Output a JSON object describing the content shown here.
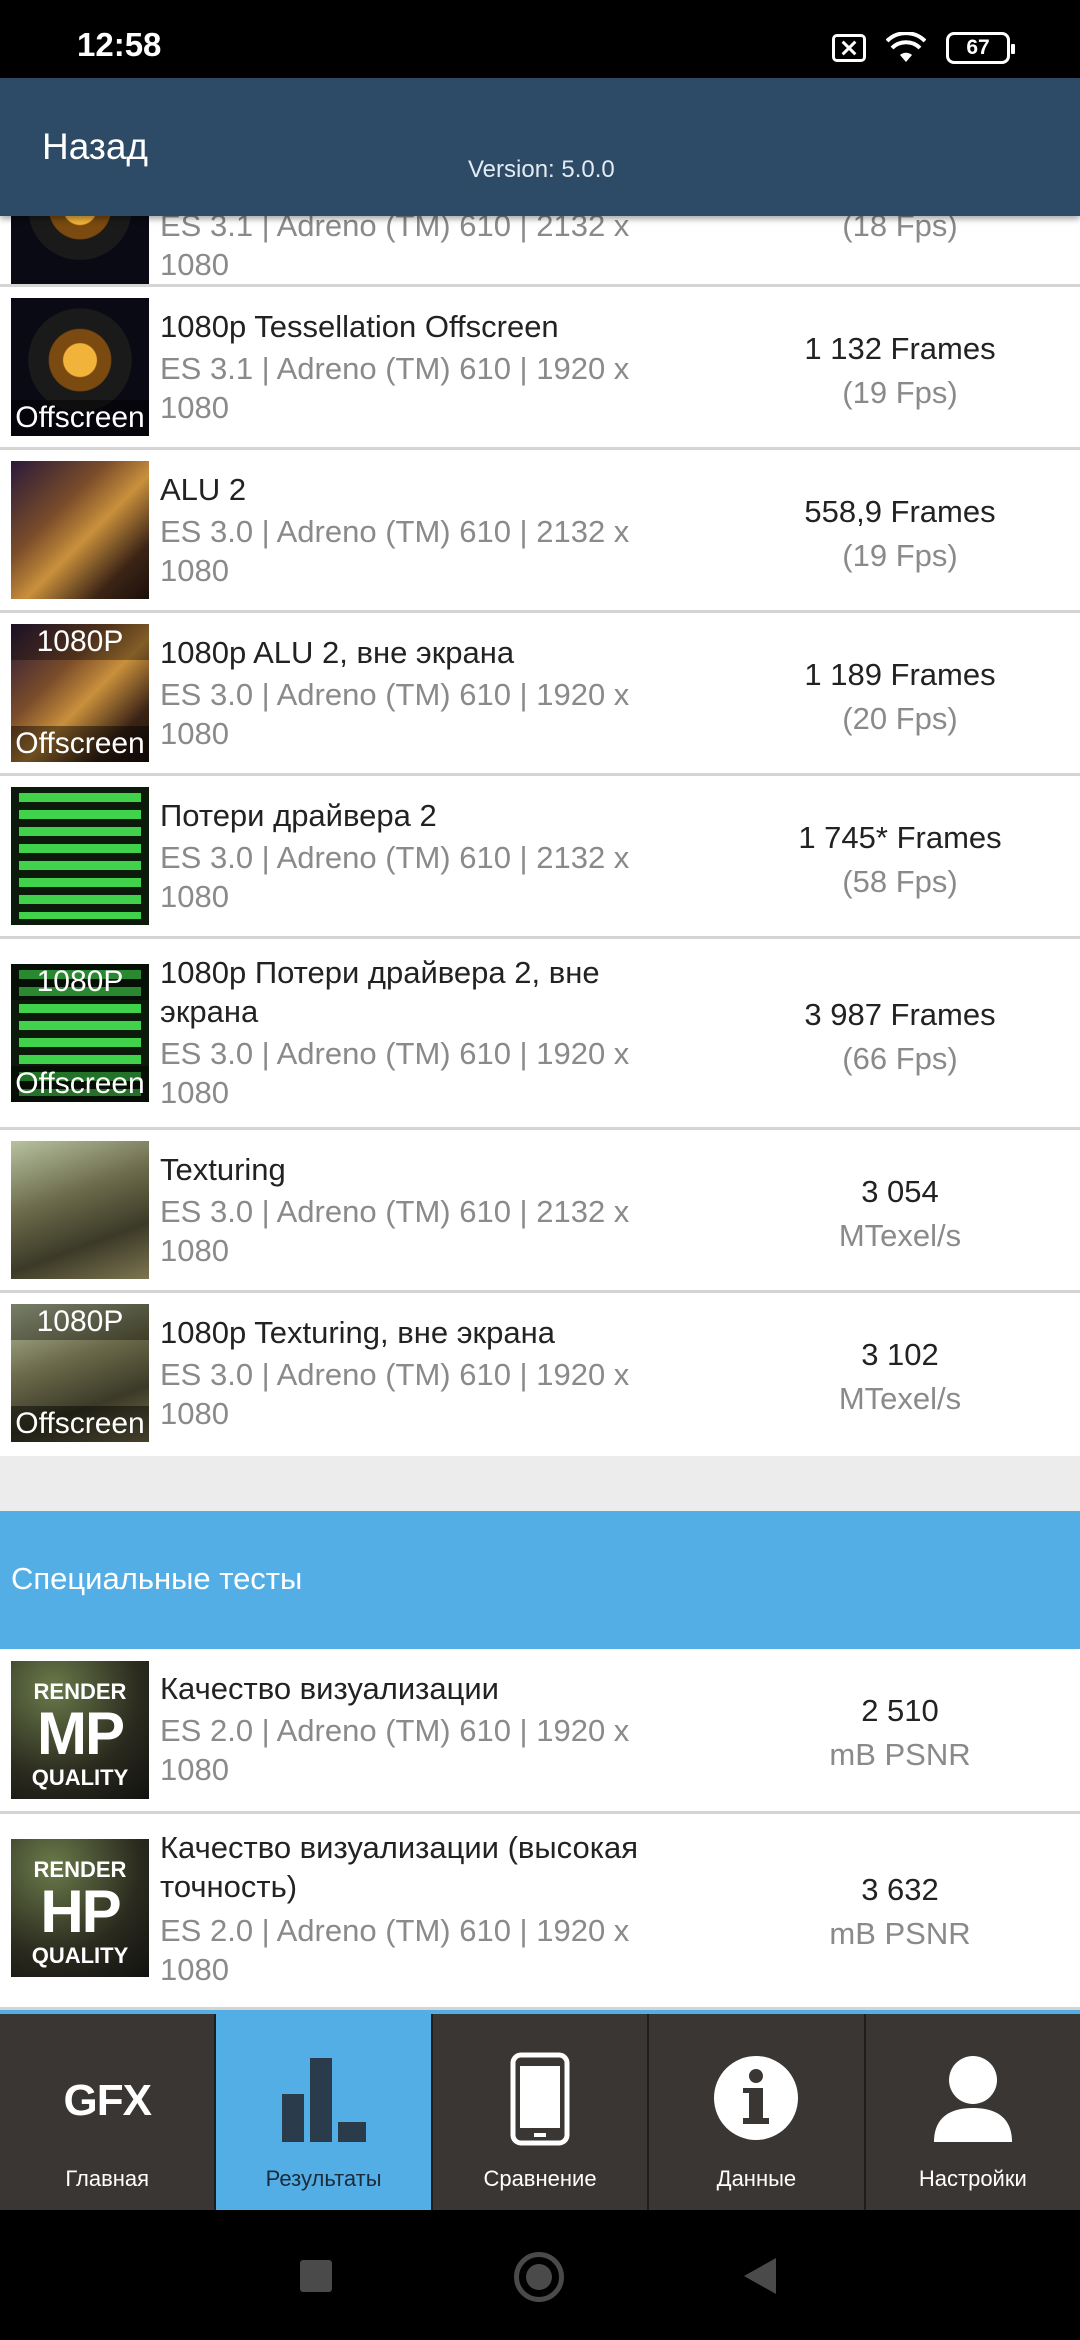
{
  "status_bar": {
    "time": "12:58",
    "battery": "67"
  },
  "header": {
    "back_label": "Назад",
    "version": "Version: 5.0.0"
  },
  "partial_row": {
    "sub_line1": "ES 3.1 | Adreno (TM) 610 | 2132 x",
    "sub_line2": "1080",
    "unit": "(18 Fps)"
  },
  "rows": [
    {
      "name": "1080p Tessellation Offscreen",
      "name2": "",
      "sub_line1": "ES 3.1 | Adreno (TM) 610 | 1920 x",
      "sub_line2": "1080",
      "score": "1 132 Frames",
      "unit": "(19 Fps)",
      "thumb_top": "",
      "thumb_bottom": "Offscreen"
    },
    {
      "name": "ALU 2",
      "name2": "",
      "sub_line1": "ES 3.0 | Adreno (TM) 610 | 2132 x",
      "sub_line2": "1080",
      "score": "558,9 Frames",
      "unit": "(19 Fps)",
      "thumb_top": "",
      "thumb_bottom": ""
    },
    {
      "name": "1080p ALU 2, вне экрана",
      "name2": "",
      "sub_line1": "ES 3.0 | Adreno (TM) 610 | 1920 x",
      "sub_line2": "1080",
      "score": "1 189 Frames",
      "unit": "(20 Fps)",
      "thumb_top": "1080P",
      "thumb_bottom": "Offscreen"
    },
    {
      "name": "Потери драйвера 2",
      "name2": "",
      "sub_line1": "ES 3.0 | Adreno (TM) 610 | 2132 x",
      "sub_line2": "1080",
      "score": "1 745* Frames",
      "unit": "(58 Fps)",
      "thumb_top": "",
      "thumb_bottom": ""
    },
    {
      "name": "1080p Потери драйвера 2, вне",
      "name2": "экрана",
      "sub_line1": "ES 3.0 | Adreno (TM) 610 | 1920 x",
      "sub_line2": "1080",
      "score": "3 987 Frames",
      "unit": "(66 Fps)",
      "thumb_top": "1080P",
      "thumb_bottom": "Offscreen"
    },
    {
      "name": "Texturing",
      "name2": "",
      "sub_line1": "ES 3.0 | Adreno (TM) 610 | 2132 x",
      "sub_line2": "1080",
      "score": "3 054",
      "unit": "MTexel/s",
      "thumb_top": "",
      "thumb_bottom": ""
    },
    {
      "name": "1080p Texturing, вне экрана",
      "name2": "",
      "sub_line1": "ES 3.0 | Adreno (TM) 610 | 1920 x",
      "sub_line2": "1080",
      "score": "3 102",
      "unit": "MTexel/s",
      "thumb_top": "1080P",
      "thumb_bottom": "Offscreen"
    }
  ],
  "special_section": {
    "title": "Специальные тесты"
  },
  "special_rows": [
    {
      "name": "Качество визуализации",
      "name2": "",
      "sub_line1": "ES 2.0 | Adreno (TM) 610 | 1920 x",
      "sub_line2": "1080",
      "score": "2 510",
      "unit": "mB PSNR",
      "thumb_r1": "RENDER",
      "thumb_r2": "MP",
      "thumb_r3": "QUALITY"
    },
    {
      "name": "Качество визуализации (высокая",
      "name2": "точность)",
      "sub_line1": "ES 2.0 | Adreno (TM) 610 | 1920 x",
      "sub_line2": "1080",
      "score": "3 632",
      "unit": "mB PSNR",
      "thumb_r1": "RENDER",
      "thumb_r2": "HP",
      "thumb_r3": "QUALITY"
    }
  ],
  "tabs": [
    {
      "label": "Главная",
      "icon": "gfx-logo-icon",
      "icon_text": "GFX"
    },
    {
      "label": "Результаты",
      "icon": "bar-chart-icon"
    },
    {
      "label": "Сравнение",
      "icon": "phone-icon"
    },
    {
      "label": "Данные",
      "icon": "info-icon"
    },
    {
      "label": "Настройки",
      "icon": "user-icon"
    }
  ],
  "active_tab": "Результаты",
  "colors": {
    "header": "#2d4b66",
    "accent": "#54aee6",
    "tabbar": "#3a3633"
  }
}
